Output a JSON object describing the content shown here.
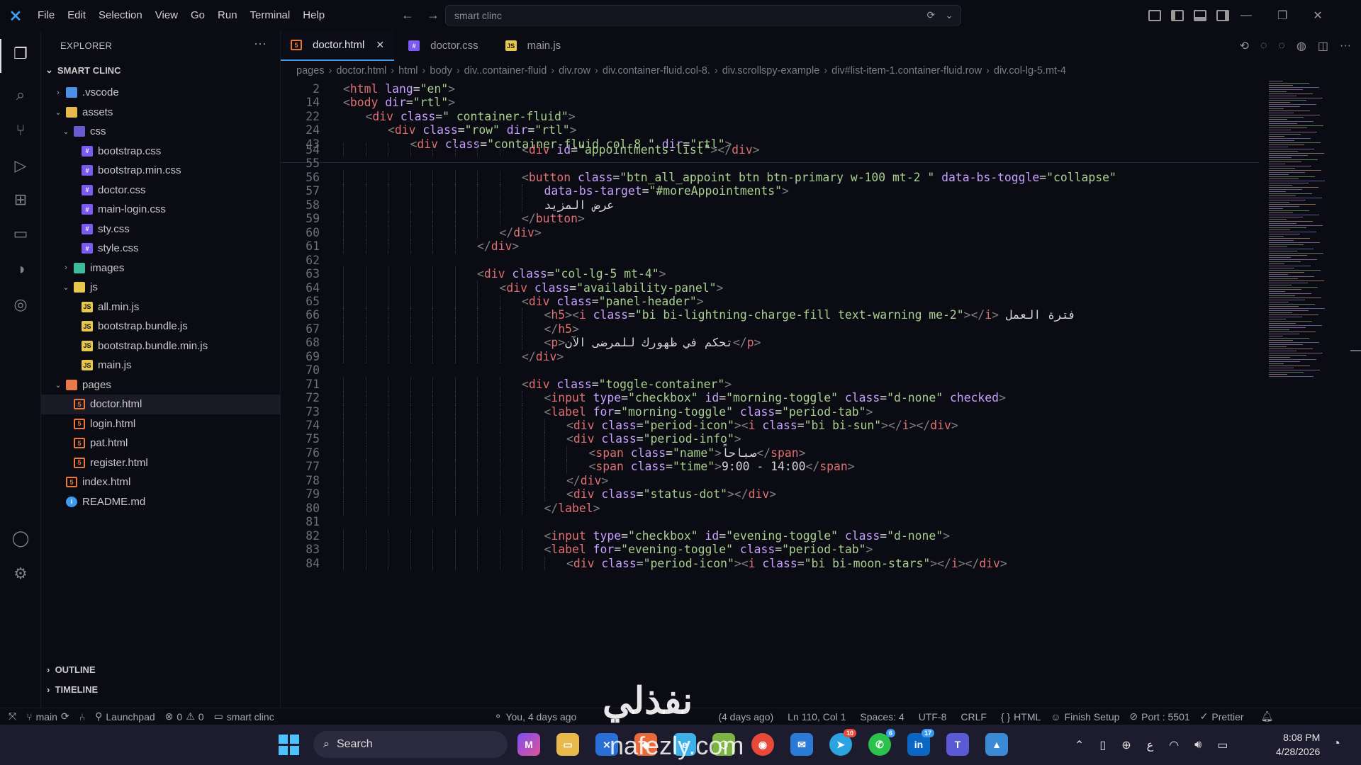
{
  "titlebar": {
    "menu": [
      "File",
      "Edit",
      "Selection",
      "View",
      "Go",
      "Run",
      "Terminal",
      "Help"
    ],
    "search_placeholder": "smart clinc"
  },
  "explorer": {
    "title": "EXPLORER",
    "more": "···",
    "project": "SMART CLINC",
    "outline": "OUTLINE",
    "timeline": "TIMELINE",
    "tree": [
      {
        "label": ".vscode",
        "type": "folder",
        "icon": "vscode-folder-icon",
        "indent": 1,
        "chev": "›"
      },
      {
        "label": "assets",
        "type": "folder",
        "icon": "folder-icon",
        "indent": 1,
        "chev": "⌄"
      },
      {
        "label": "css",
        "type": "folder",
        "icon": "css-folder-icon",
        "indent": 2,
        "chev": "⌄"
      },
      {
        "label": "bootstrap.css",
        "type": "css",
        "icon": "css-file-icon",
        "indent": 3,
        "chev": ""
      },
      {
        "label": "bootstrap.min.css",
        "type": "css",
        "icon": "css-file-icon",
        "indent": 3,
        "chev": ""
      },
      {
        "label": "doctor.css",
        "type": "css",
        "icon": "css-file-icon",
        "indent": 3,
        "chev": ""
      },
      {
        "label": "main-login.css",
        "type": "css",
        "icon": "css-file-icon",
        "indent": 3,
        "chev": ""
      },
      {
        "label": "sty.css",
        "type": "css",
        "icon": "css-file-icon",
        "indent": 3,
        "chev": ""
      },
      {
        "label": "style.css",
        "type": "css",
        "icon": "css-file-icon",
        "indent": 3,
        "chev": ""
      },
      {
        "label": "images",
        "type": "folder",
        "icon": "images-folder-icon",
        "indent": 2,
        "chev": "›"
      },
      {
        "label": "js",
        "type": "folder",
        "icon": "js-folder-icon",
        "indent": 2,
        "chev": "⌄"
      },
      {
        "label": "all.min.js",
        "type": "js",
        "icon": "js-file-icon",
        "indent": 3,
        "chev": ""
      },
      {
        "label": "bootstrap.bundle.js",
        "type": "js",
        "icon": "js-file-icon",
        "indent": 3,
        "chev": ""
      },
      {
        "label": "bootstrap.bundle.min.js",
        "type": "js",
        "icon": "js-file-icon",
        "indent": 3,
        "chev": ""
      },
      {
        "label": "main.js",
        "type": "js",
        "icon": "js-file-icon",
        "indent": 3,
        "chev": ""
      },
      {
        "label": "pages",
        "type": "folder",
        "icon": "pages-folder-icon",
        "indent": 1,
        "chev": "⌄"
      },
      {
        "label": "doctor.html",
        "type": "html",
        "icon": "html-file-icon",
        "indent": 2,
        "chev": "",
        "selected": true
      },
      {
        "label": "login.html",
        "type": "html",
        "icon": "html-file-icon",
        "indent": 2,
        "chev": ""
      },
      {
        "label": "pat.html",
        "type": "html",
        "icon": "html-file-icon",
        "indent": 2,
        "chev": ""
      },
      {
        "label": "register.html",
        "type": "html",
        "icon": "html-file-icon",
        "indent": 2,
        "chev": ""
      },
      {
        "label": "index.html",
        "type": "html",
        "icon": "html-file-icon",
        "indent": 1,
        "chev": ""
      },
      {
        "label": "README.md",
        "type": "info",
        "icon": "info-icon",
        "indent": 1,
        "chev": ""
      }
    ]
  },
  "tabs": [
    {
      "label": "doctor.html",
      "icon": "html-file-icon",
      "active": true
    },
    {
      "label": "doctor.css",
      "icon": "css-file-icon",
      "active": false
    },
    {
      "label": "main.js",
      "icon": "js-file-icon",
      "active": false
    }
  ],
  "breadcrumb": [
    "pages",
    "doctor.html",
    "html",
    "body",
    "div..container-fluid",
    "div.row",
    "div.container-fluid.col-8.",
    "div.scrollspy-example",
    "div#list-item-1.container-fluid.row",
    "div.col-lg-5.mt-4"
  ],
  "sticky": [
    {
      "n": "2",
      "indent": 0,
      "html": "<span class='pu'>&lt;</span><span class='tg'>html</span> <span class='at'>lang</span><span class='tx'>=</span><span class='st'>\"en\"</span><span class='pu'>&gt;</span>"
    },
    {
      "n": "14",
      "indent": 0,
      "html": "<span class='pu'>&lt;</span><span class='tg'>body</span> <span class='at'>dir</span><span class='tx'>=</span><span class='st'>\"rtl\"</span><span class='pu'>&gt;</span>"
    },
    {
      "n": "22",
      "indent": 1,
      "html": "<span class='pu'>&lt;</span><span class='tg'>div</span> <span class='at'>class</span><span class='tx'>=</span><span class='st'>\" container-fluid\"</span><span class='pu'>&gt;</span>"
    },
    {
      "n": "24",
      "indent": 2,
      "html": "<span class='pu'>&lt;</span><span class='tg'>div</span> <span class='at'>class</span><span class='tx'>=</span><span class='st'>\"row\"</span> <span class='at'>dir</span><span class='tx'>=</span><span class='st'>\"rtl\"</span><span class='pu'>&gt;</span>"
    },
    {
      "n": "43",
      "indent": 3,
      "html": "<span class='pu'>&lt;</span><span class='tg'>div</span> <span class='at'>class</span><span class='tx'>=</span><span class='st'>\"container-fluid col-8 \"</span> <span class='at'>dir</span><span class='tx'>=</span><span class='st'>\"rtl\"</span><span class='pu'>&gt;</span>"
    }
  ],
  "code": [
    {
      "n": "54",
      "indent": 8,
      "html": "<span class='pu'>&lt;</span><span class='tg'>div</span> <span class='at'>id</span><span class='tx'>=</span><span class='st'>\"appointments-list\"</span><span class='pu'>&gt;&lt;/</span><span class='tg'>div</span><span class='pu'>&gt;</span>"
    },
    {
      "n": "55",
      "indent": 0,
      "html": ""
    },
    {
      "n": "56",
      "indent": 8,
      "html": "<span class='pu'>&lt;</span><span class='tg'>button</span> <span class='at'>class</span><span class='tx'>=</span><span class='st'>\"btn_all_appoint btn btn-primary w-100 mt-2 \"</span> <span class='at'>data-bs-toggle</span><span class='tx'>=</span><span class='st'>\"collapse\"</span>"
    },
    {
      "n": "57",
      "indent": 9,
      "html": "<span class='at'>data-bs-target</span><span class='tx'>=</span><span class='st'>\"#moreAppointments\"</span><span class='pu'>&gt;</span>"
    },
    {
      "n": "58",
      "indent": 9,
      "html": "<span class='tx'>عرض المزيد</span>"
    },
    {
      "n": "59",
      "indent": 8,
      "html": "<span class='pu'>&lt;/</span><span class='tg'>button</span><span class='pu'>&gt;</span>"
    },
    {
      "n": "60",
      "indent": 7,
      "html": "<span class='pu'>&lt;/</span><span class='tg'>div</span><span class='pu'>&gt;</span>"
    },
    {
      "n": "61",
      "indent": 6,
      "html": "<span class='pu'>&lt;/</span><span class='tg'>div</span><span class='pu'>&gt;</span>"
    },
    {
      "n": "62",
      "indent": 0,
      "html": ""
    },
    {
      "n": "63",
      "indent": 6,
      "html": "<span class='pu'>&lt;</span><span class='tg'>div</span> <span class='at'>class</span><span class='tx'>=</span><span class='st'>\"col-lg-5 mt-4\"</span><span class='pu'>&gt;</span>"
    },
    {
      "n": "64",
      "indent": 7,
      "html": "<span class='pu'>&lt;</span><span class='tg'>div</span> <span class='at'>class</span><span class='tx'>=</span><span class='st'>\"availability-panel\"</span><span class='pu'>&gt;</span>"
    },
    {
      "n": "65",
      "indent": 8,
      "html": "<span class='pu'>&lt;</span><span class='tg'>div</span> <span class='at'>class</span><span class='tx'>=</span><span class='st'>\"panel-header\"</span><span class='pu'>&gt;</span>"
    },
    {
      "n": "66",
      "indent": 9,
      "html": "<span class='pu'>&lt;</span><span class='tg'>h5</span><span class='pu'>&gt;&lt;</span><span class='tg'>i</span> <span class='at'>class</span><span class='tx'>=</span><span class='st'>\"bi bi-lightning-charge-fill text-warning me-2\"</span><span class='pu'>&gt;&lt;/</span><span class='tg'>i</span><span class='pu'>&gt;</span> <span class='tx'>فترة العمل</span>"
    },
    {
      "n": "67",
      "indent": 9,
      "html": "<span class='pu'>&lt;/</span><span class='tg'>h5</span><span class='pu'>&gt;</span>"
    },
    {
      "n": "68",
      "indent": 9,
      "html": "<span class='pu'>&lt;</span><span class='tg'>p</span><span class='pu'>&gt;</span><span class='tx'>تحكم في ظهورك للمرضى الآن</span><span class='pu'>&lt;/</span><span class='tg'>p</span><span class='pu'>&gt;</span>"
    },
    {
      "n": "69",
      "indent": 8,
      "html": "<span class='pu'>&lt;/</span><span class='tg'>div</span><span class='pu'>&gt;</span>"
    },
    {
      "n": "70",
      "indent": 0,
      "html": ""
    },
    {
      "n": "71",
      "indent": 8,
      "html": "<span class='pu'>&lt;</span><span class='tg'>div</span> <span class='at'>class</span><span class='tx'>=</span><span class='st'>\"toggle-container\"</span><span class='pu'>&gt;</span>"
    },
    {
      "n": "72",
      "indent": 9,
      "html": "<span class='pu'>&lt;</span><span class='tg'>input</span> <span class='at'>type</span><span class='tx'>=</span><span class='st'>\"checkbox\"</span> <span class='at'>id</span><span class='tx'>=</span><span class='st'>\"morning-toggle\"</span> <span class='at'>class</span><span class='tx'>=</span><span class='st'>\"d-none\"</span> <span class='at'>checked</span><span class='pu'>&gt;</span>"
    },
    {
      "n": "73",
      "indent": 9,
      "html": "<span class='pu'>&lt;</span><span class='tg'>label</span> <span class='at'>for</span><span class='tx'>=</span><span class='st'>\"morning-toggle\"</span> <span class='at'>class</span><span class='tx'>=</span><span class='st'>\"period-tab\"</span><span class='pu'>&gt;</span>"
    },
    {
      "n": "74",
      "indent": 10,
      "html": "<span class='pu'>&lt;</span><span class='tg'>div</span> <span class='at'>class</span><span class='tx'>=</span><span class='st'>\"period-icon\"</span><span class='pu'>&gt;&lt;</span><span class='tg'>i</span> <span class='at'>class</span><span class='tx'>=</span><span class='st'>\"bi bi-sun\"</span><span class='pu'>&gt;&lt;/</span><span class='tg'>i</span><span class='pu'>&gt;&lt;/</span><span class='tg'>div</span><span class='pu'>&gt;</span>"
    },
    {
      "n": "75",
      "indent": 10,
      "html": "<span class='pu'>&lt;</span><span class='tg'>div</span> <span class='at'>class</span><span class='tx'>=</span><span class='st'>\"period-info\"</span><span class='pu'>&gt;</span>"
    },
    {
      "n": "76",
      "indent": 11,
      "html": "<span class='pu'>&lt;</span><span class='tg'>span</span> <span class='at'>class</span><span class='tx'>=</span><span class='st'>\"name\"</span><span class='pu'>&gt;</span><span class='tx'>صباحاً</span><span class='pu'>&lt;/</span><span class='tg'>span</span><span class='pu'>&gt;</span>"
    },
    {
      "n": "77",
      "indent": 11,
      "html": "<span class='pu'>&lt;</span><span class='tg'>span</span> <span class='at'>class</span><span class='tx'>=</span><span class='st'>\"time\"</span><span class='pu'>&gt;</span><span class='tx'>9:00 - 14:00</span><span class='pu'>&lt;/</span><span class='tg'>span</span><span class='pu'>&gt;</span>"
    },
    {
      "n": "78",
      "indent": 10,
      "html": "<span class='pu'>&lt;/</span><span class='tg'>div</span><span class='pu'>&gt;</span>"
    },
    {
      "n": "79",
      "indent": 10,
      "html": "<span class='pu'>&lt;</span><span class='tg'>div</span> <span class='at'>class</span><span class='tx'>=</span><span class='st'>\"status-dot\"</span><span class='pu'>&gt;&lt;/</span><span class='tg'>div</span><span class='pu'>&gt;</span>"
    },
    {
      "n": "80",
      "indent": 9,
      "html": "<span class='pu'>&lt;/</span><span class='tg'>label</span><span class='pu'>&gt;</span>"
    },
    {
      "n": "81",
      "indent": 0,
      "html": ""
    },
    {
      "n": "82",
      "indent": 9,
      "html": "<span class='pu'>&lt;</span><span class='tg'>input</span> <span class='at'>type</span><span class='tx'>=</span><span class='st'>\"checkbox\"</span> <span class='at'>id</span><span class='tx'>=</span><span class='st'>\"evening-toggle\"</span> <span class='at'>class</span><span class='tx'>=</span><span class='st'>\"d-none\"</span><span class='pu'>&gt;</span>"
    },
    {
      "n": "83",
      "indent": 9,
      "html": "<span class='pu'>&lt;</span><span class='tg'>label</span> <span class='at'>for</span><span class='tx'>=</span><span class='st'>\"evening-toggle\"</span> <span class='at'>class</span><span class='tx'>=</span><span class='st'>\"period-tab\"</span><span class='pu'>&gt;</span>"
    },
    {
      "n": "84",
      "indent": 10,
      "html": "<span class='pu'>&lt;</span><span class='tg'>div</span> <span class='at'>class</span><span class='tx'>=</span><span class='st'>\"period-icon\"</span><span class='pu'>&gt;&lt;</span><span class='tg'>i</span> <span class='at'>class</span><span class='tx'>=</span><span class='st'>\"bi bi-moon-stars\"</span><span class='pu'>&gt;&lt;/</span><span class='tg'>i</span><span class='pu'>&gt;&lt;/</span><span class='tg'>div</span><span class='pu'>&gt;</span>"
    }
  ],
  "statusbar": {
    "branch": "main",
    "launchpad": "Launchpad",
    "errors": "0",
    "warnings": "0",
    "folder": "smart clinc",
    "blame": "You, 4 days ago",
    "blame_detail": "(4 days ago)",
    "cursor": "Ln 110, Col 1",
    "spaces": "Spaces: 4",
    "encoding": "UTF-8",
    "eol": "CRLF",
    "language": "HTML",
    "finish_setup": "Finish Setup",
    "port": "Port : 5501",
    "prettier": "Prettier"
  },
  "taskbar": {
    "search": "Search",
    "time": "8:08 PM",
    "date": "4/28/2026",
    "lang": "ع",
    "badges": {
      "telegram": "10",
      "whatsapp": "6",
      "linkedin": "17"
    }
  },
  "watermark": {
    "arabic": "نفذلي",
    "latin": "nafezly.com"
  },
  "colors": {
    "accent": "#3c9cf0",
    "background": "#0b0b14",
    "tag": "#e07070",
    "attr": "#c8a0ff",
    "string": "#a8d08d"
  }
}
